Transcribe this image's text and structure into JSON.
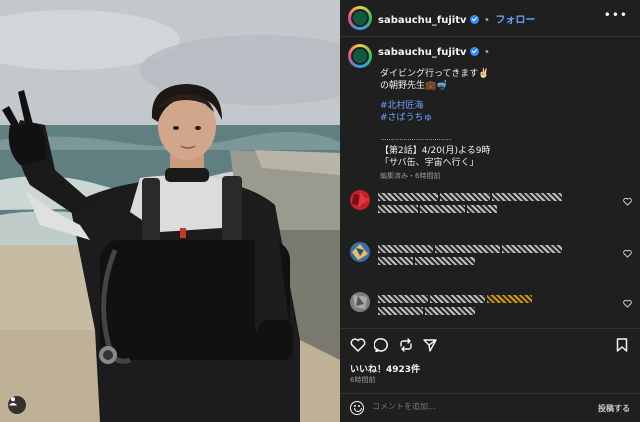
{
  "header": {
    "username": "sabauchu_fujitv",
    "separator": "•",
    "follow_label": "フォロー",
    "more_icon": "more-horizontal-icon"
  },
  "post": {
    "username": "sabauchu_fujitv",
    "caption_line1": "ダイビング行ってきます✌🏻",
    "caption_line2": "の朝野先生💼🤿",
    "hashtag1": "#北村匠海",
    "hashtag2": "#さばうちゅ",
    "dots_line": "‥‥‥‥‥‥‥‥‥‥‥‥‥‥‥‥‥",
    "episode_line1": "【第2話】4/20(月)よる9時",
    "episode_line2": "「サバ缶、宇宙へ行く」",
    "edited": "編集済み・6時間前"
  },
  "comments": [
    {
      "avatar_color": "#c7202b"
    },
    {
      "avatar_color": "#3b6ea8"
    },
    {
      "avatar_color": "#7d7d7d"
    }
  ],
  "actions": {
    "like_icon": "heart-icon",
    "comment_icon": "comment-icon",
    "repost_icon": "repost-icon",
    "share_icon": "send-icon",
    "save_icon": "bookmark-icon"
  },
  "likes_text": "いいね！4923件",
  "time_text": "6時間前",
  "comment_box": {
    "placeholder": "コメントを追加...",
    "post_label": "投稿する"
  },
  "colors": {
    "panel_bg": "#1f1f1f",
    "link_blue": "#5fa8ff",
    "verified_blue": "#2f8cf7"
  }
}
